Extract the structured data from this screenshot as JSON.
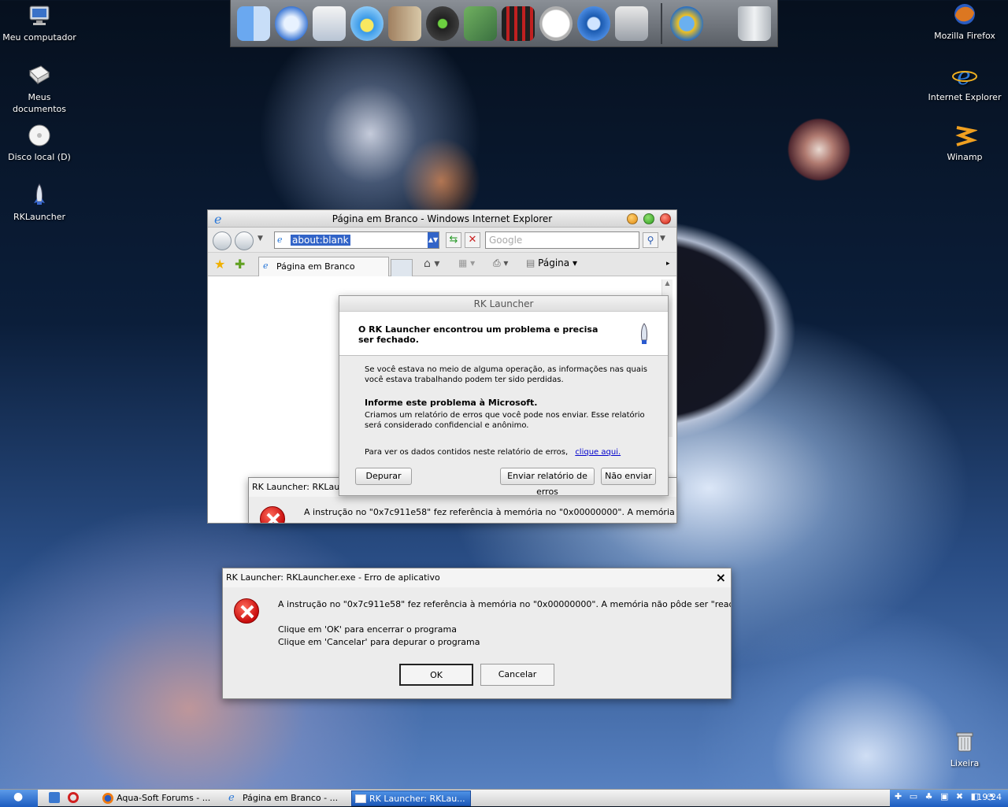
{
  "desktop": {
    "icons_left": [
      {
        "label": "Meu computador"
      },
      {
        "label": "Meus documentos"
      },
      {
        "label": "Disco local (D)"
      },
      {
        "label": "RKLauncher"
      }
    ],
    "icons_right": [
      {
        "label": "Mozilla Firefox"
      },
      {
        "label": "Internet Explorer"
      },
      {
        "label": "Winamp"
      },
      {
        "label": "Lixeira"
      }
    ]
  },
  "dock": {
    "items": [
      "finder-icon",
      "safari-icon",
      "mail-icon",
      "ichat-icon",
      "address-book-icon",
      "itunes-icon",
      "iphoto-icon",
      "imovie-icon",
      "ical-icon",
      "quicktime-icon",
      "system-preferences-icon",
      "internet-connect-icon",
      "trash-icon"
    ]
  },
  "ie": {
    "title": "Página em Branco - Windows Internet Explorer",
    "address": "about:blank",
    "search_placeholder": "Google",
    "tab_label": "Página em Branco",
    "page_menu": "Página"
  },
  "rk_dialog": {
    "title": "RK Launcher",
    "headline": "O RK Launcher encontrou um problema e precisa ser fechado.",
    "para1": "Se você estava no meio de alguma operação, as informações nas quais você estava trabalhando podem ter sido perdidas.",
    "report_heading": "Informe este problema à Microsoft.",
    "para2": "Criamos um relatório de erros que você pode nos enviar. Esse relatório será considerado confidencial e anônimo.",
    "data_text": "Para ver os dados contidos neste relatório de erros,",
    "data_link": "clique aqui.",
    "btn_debug": "Depurar",
    "btn_send": "Enviar relatório de erros",
    "btn_dont_send": "Não enviar"
  },
  "err_back": {
    "title": "RK Launcher: RKLaun",
    "message": "A instrução no \"0x7c911e58\" fez referência à memória no \"0x00000000\". A memória não"
  },
  "err_front": {
    "title": "RK Launcher: RKLauncher.exe - Erro de aplicativo",
    "close": "×",
    "message": "A instrução no \"0x7c911e58\" fez referência à memória no \"0x00000000\". A memória não pôde ser \"read\".",
    "line_ok": "Clique em 'OK' para encerrar o programa",
    "line_cancel": "Clique em 'Cancelar' para depurar o programa",
    "btn_ok": "OK",
    "btn_cancel": "Cancelar"
  },
  "taskbar": {
    "tasks": [
      {
        "label": "Aqua-Soft Forums - ..."
      },
      {
        "label": "Página em Branco - ..."
      },
      {
        "label": "RK Launcher: RKLau..."
      }
    ],
    "clock": "19:24"
  },
  "colors": {
    "accent": "#1c5cc0",
    "error": "#c80c0c",
    "link": "#0000cc"
  }
}
